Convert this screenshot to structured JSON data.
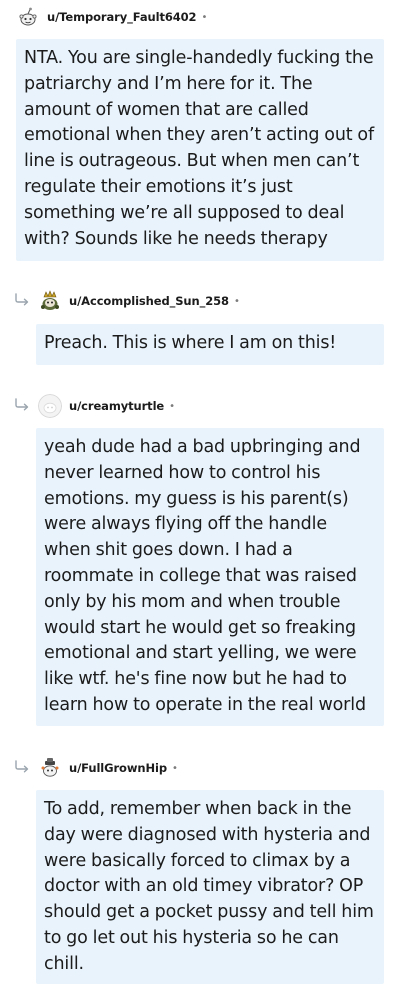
{
  "comments": [
    {
      "username": "u/Temporary_Fault6402",
      "separator": "•",
      "avatar_icon": "snoo-avatar-icon",
      "is_reply": false,
      "body": "NTA. You are single-handedly fucking the patriarchy and I’m here for it. The amount of women that are called emotional when they aren’t acting out of line is outrageous. But when men can’t regulate their emotions it’s just something we’re all supposed to deal with? Sounds like he needs therapy"
    },
    {
      "username": "u/Accomplished_Sun_258",
      "separator": "•",
      "avatar_icon": "snoo-avatar-icon",
      "is_reply": true,
      "body": "Preach. This is where I am on this!"
    },
    {
      "username": "u/creamyturtle",
      "separator": "•",
      "avatar_icon": "snoo-avatar-icon",
      "is_reply": true,
      "body": "yeah dude had a bad upbringing and never learned how to control his emotions. my guess is his parent(s) were always flying off the handle when shit goes down. I had a roommate in college that was raised only by his mom and when trouble would start he would get so freaking emotional and start yelling, we were like wtf. he's fine now but he had to learn how to operate in the real world"
    },
    {
      "username": "u/FullGrownHip",
      "separator": "•",
      "avatar_icon": "snoo-avatar-icon",
      "is_reply": true,
      "body": "To add, remember when back in the day were diagnosed with hysteria and were basically forced to climax by a doctor with an old timey vibrator? OP should get a pocket pussy and tell him to go let out his hysteria so he can chill."
    }
  ],
  "colors": {
    "bubble_background": "#e8f3fc",
    "username_text": "#1c1c1c",
    "separator": "#7c7c7c",
    "reply_arrow": "#9aa4ad"
  }
}
